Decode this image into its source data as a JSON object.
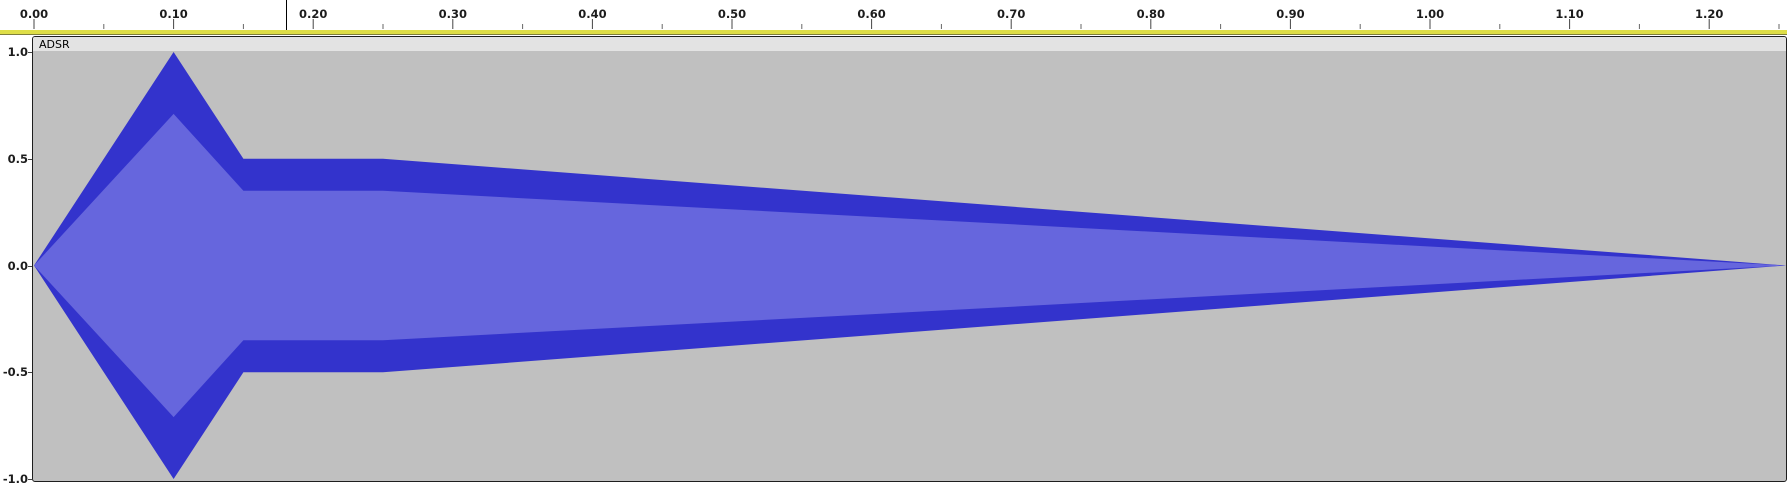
{
  "ruler": {
    "ticks": [
      "0.00",
      "0.10",
      "0.20",
      "0.30",
      "0.40",
      "0.50",
      "0.60",
      "0.70",
      "0.80",
      "0.90",
      "1.00",
      "1.10",
      "1.20"
    ]
  },
  "track": {
    "clip_name": "ADSR",
    "amplitude_labels": [
      "1.0",
      "0.5",
      "0.0",
      "-0.5",
      "-1.0"
    ]
  },
  "envelope": {
    "time_points": [
      0.0,
      0.1,
      0.15,
      0.25,
      1.255
    ],
    "peak_values": [
      0.0,
      1.0,
      0.5,
      0.5,
      0.0
    ],
    "rms_values": [
      0.0,
      0.71,
      0.35,
      0.35,
      0.0
    ]
  },
  "colors": {
    "waveform_peak": "#3333cc",
    "waveform_rms": "#6666dd",
    "track_background": "#c0c0c0",
    "timeline_strip": "#dede47"
  }
}
